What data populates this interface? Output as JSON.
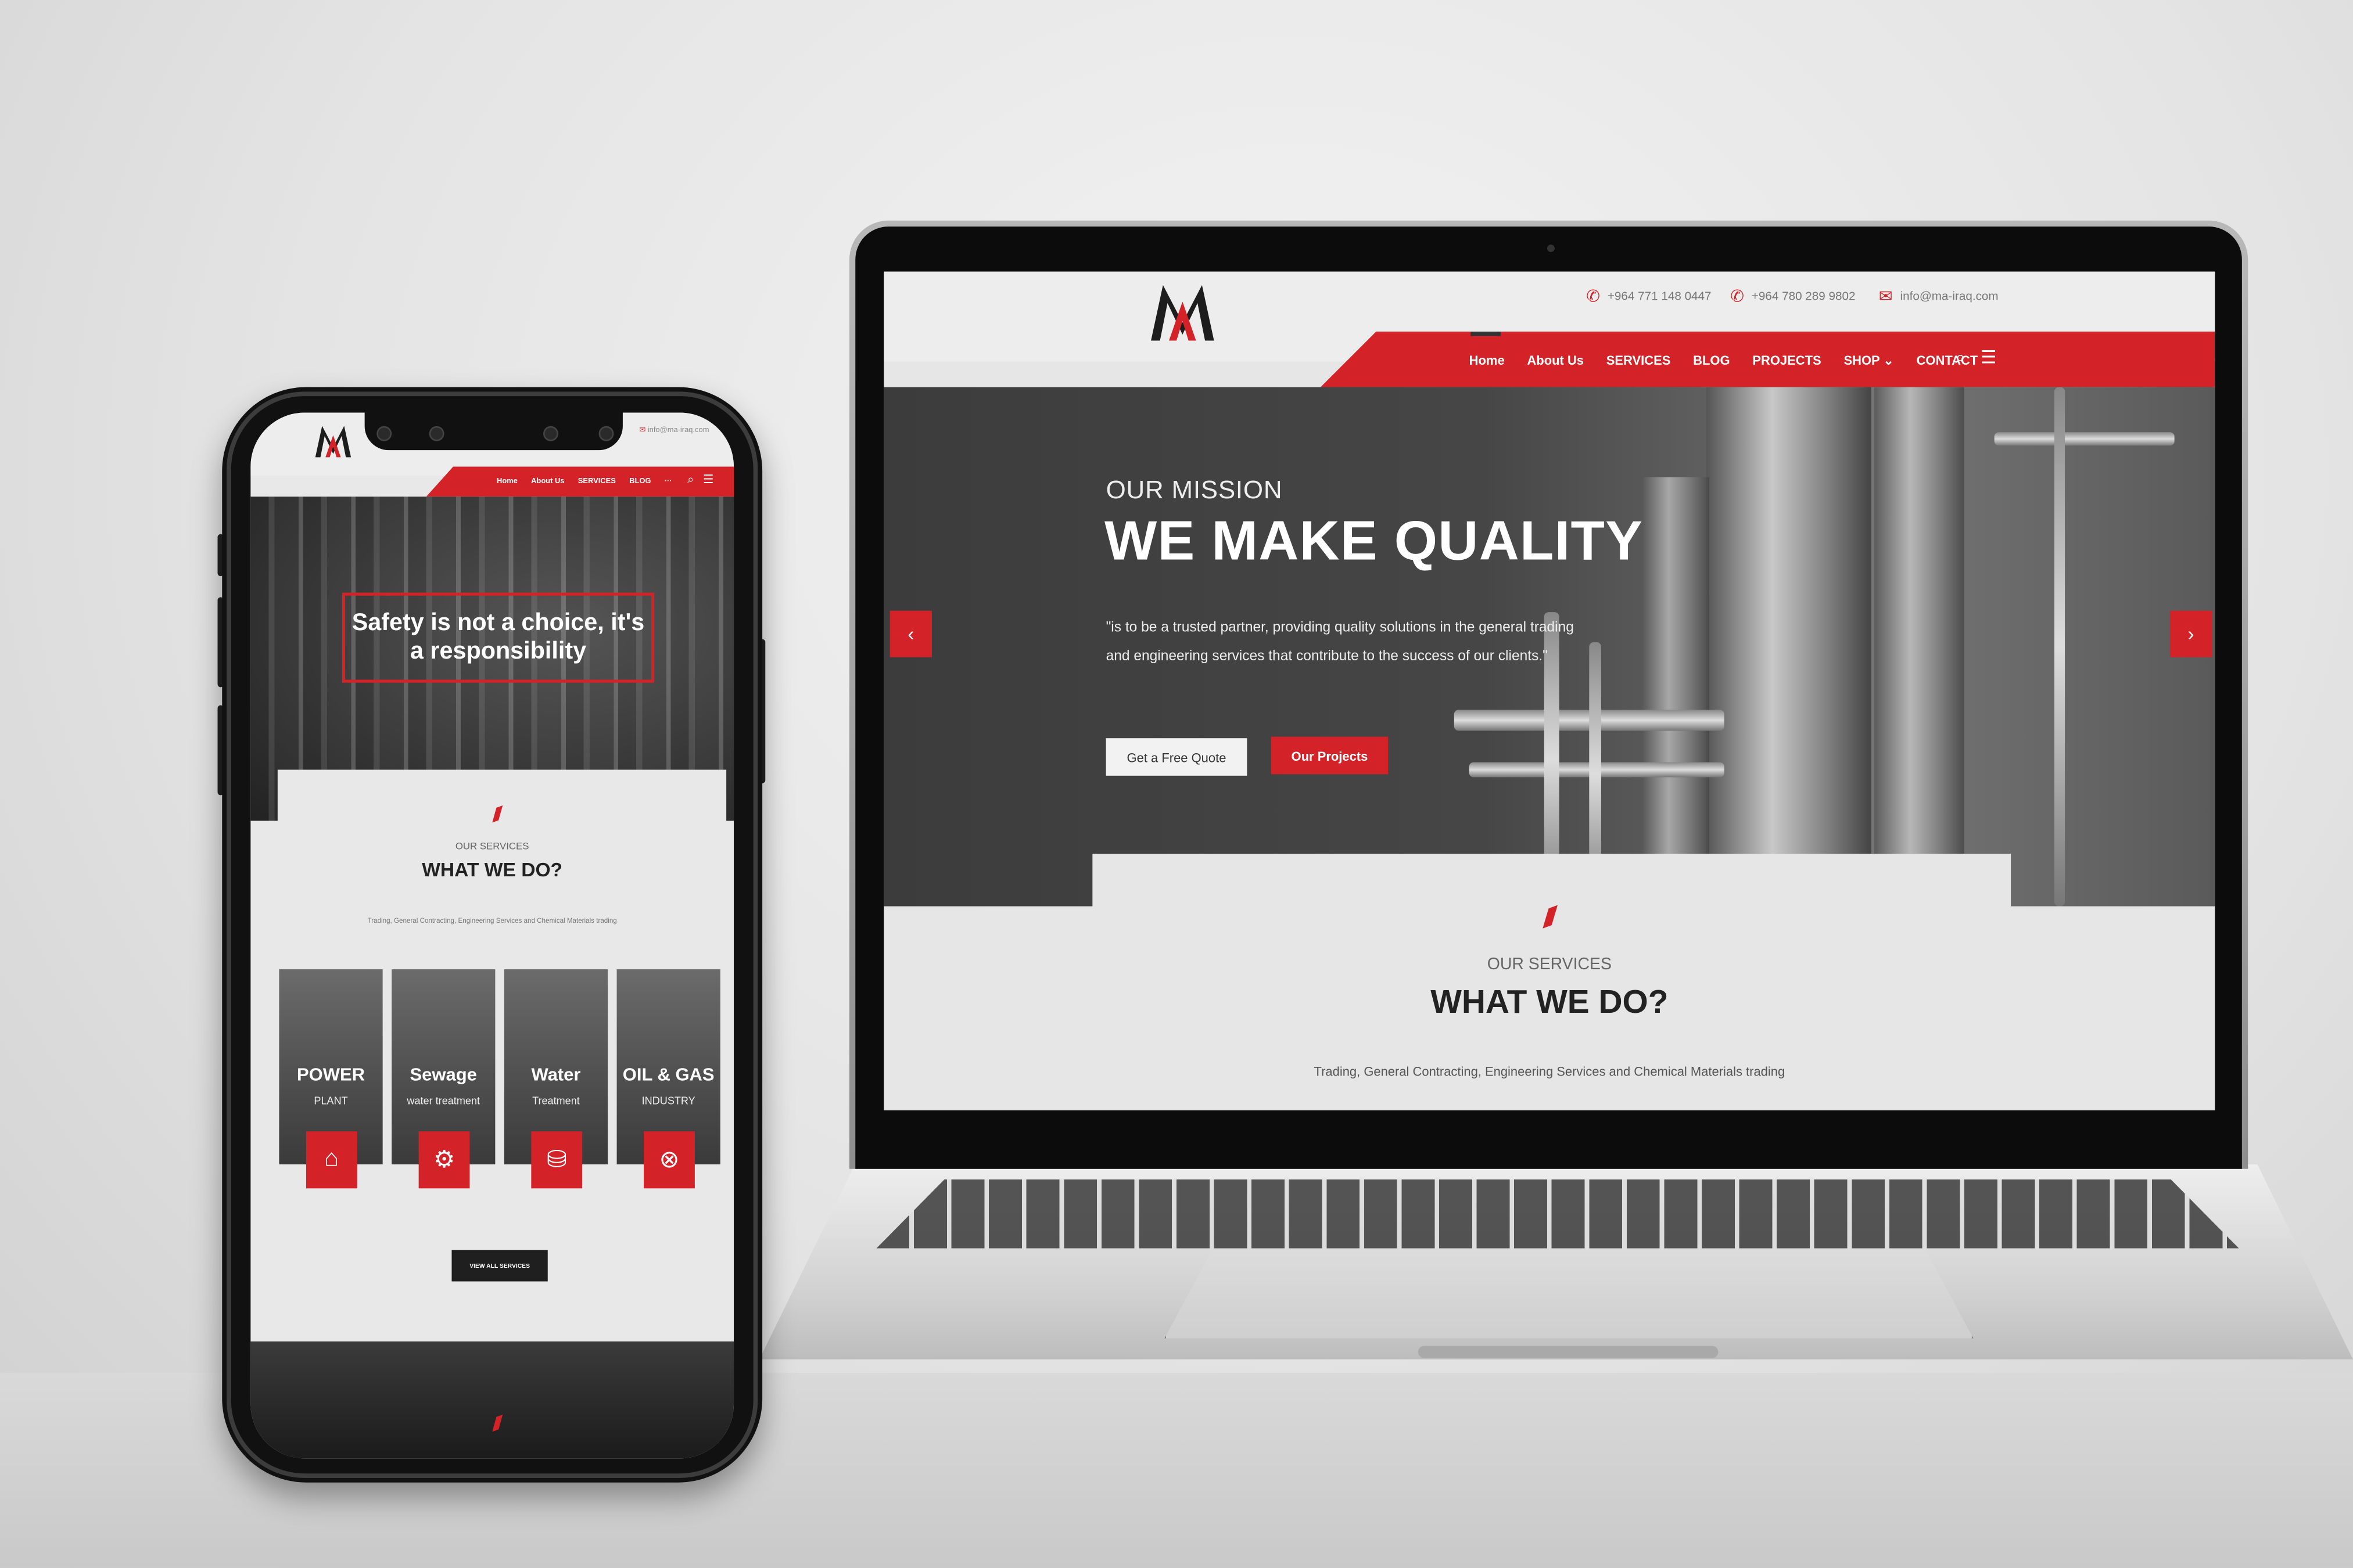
{
  "brand": {
    "name": "MA",
    "accent_color": "#d32328",
    "dark_color": "#222222"
  },
  "laptop": {
    "contacts": [
      {
        "icon": "phone-icon",
        "text": "+964 771 148 0447"
      },
      {
        "icon": "phone-icon",
        "text": "+964 780 289 9802"
      },
      {
        "icon": "mail-icon",
        "text": "info@ma-iraq.com"
      }
    ],
    "nav": [
      "Home",
      "About Us",
      "SERVICES",
      "BLOG",
      "PROJECTS",
      "SHOP",
      "CONTACT"
    ],
    "hero": {
      "subtitle": "OUR MISSION",
      "title": "WE MAKE QUALITY",
      "quote": "\"is to be a trusted partner, providing quality solutions in the general trading and engineering services that contribute to the success of our clients.\"",
      "btn_quote": "Get a Free Quote",
      "btn_projects": "Our Projects",
      "prev": "‹",
      "next": "›"
    },
    "services": {
      "label": "OUR SERVICES",
      "title": "WHAT WE DO?",
      "desc": "Trading, General Contracting, Engineering Services and Chemical Materials trading"
    }
  },
  "phone": {
    "email": "info@ma-iraq.com",
    "nav": [
      "Home",
      "About Us",
      "SERVICES",
      "BLOG",
      "···"
    ],
    "hero_text": "Safety is not a choice, it's a responsibility",
    "services": {
      "label": "OUR SERVICES",
      "title": "WHAT WE DO?",
      "desc": "Trading, General Contracting, Engineering Services and Chemical Materials trading"
    },
    "cards": [
      {
        "title": "POWER",
        "sub": "PLANT",
        "icon": "factory-icon"
      },
      {
        "title": "Sewage",
        "sub": "water treatment",
        "icon": "pump-icon"
      },
      {
        "title": "Water",
        "sub": "Treatment",
        "icon": "tanks-icon"
      },
      {
        "title": "OIL & GAS",
        "sub": "INDUSTRY",
        "icon": "valve-icon"
      }
    ],
    "view_all": "VIEW ALL SERVICES"
  }
}
